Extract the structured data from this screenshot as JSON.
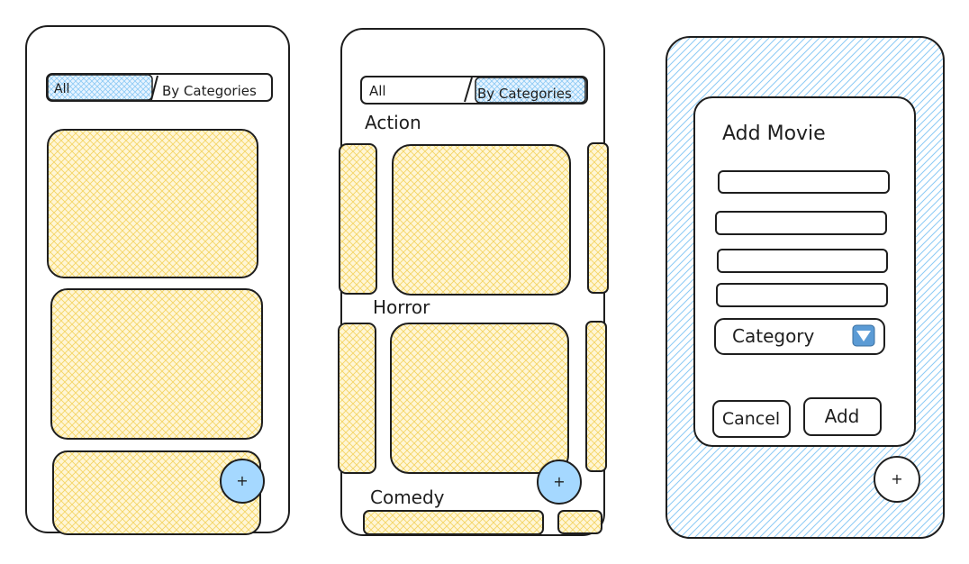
{
  "colors": {
    "ink": "#1e1e1e",
    "yellow_fill": "#ffec99",
    "yellow_hatch": "#ffe066",
    "blue_fill": "#a5d8ff",
    "blue_hatch": "#74c0fc",
    "fab_blue": "#a5d8ff"
  },
  "screen1": {
    "tab_all": "All",
    "tab_categories": "By Categories",
    "fab_label": "+"
  },
  "screen2": {
    "tab_all": "All",
    "tab_categories": "By Categories",
    "section_action": "Action",
    "section_horror": "Horror",
    "section_comedy": "Comedy",
    "fab_label": "+"
  },
  "screen3": {
    "dialog_title": "Add Movie",
    "category_select": "Category",
    "cancel_label": "Cancel",
    "add_label": "Add",
    "fab_label": "+",
    "dropdown_icon": "chevron-down-icon"
  }
}
